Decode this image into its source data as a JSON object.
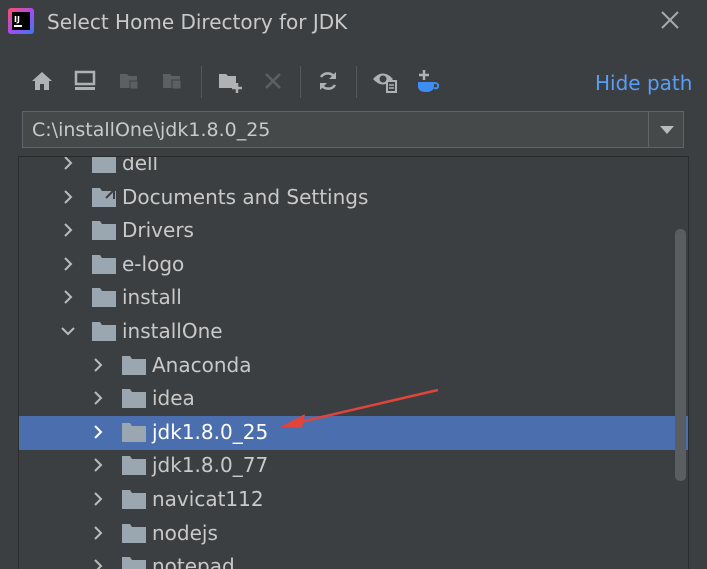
{
  "window": {
    "title": "Select Home Directory for JDK",
    "logo_text": "IJ"
  },
  "toolbar": {
    "hide_path_label": "Hide path",
    "buttons": [
      "home-icon",
      "desktop-icon",
      "project-icon",
      "module-icon",
      "new-folder-icon",
      "delete-icon",
      "refresh-icon",
      "show-hidden-icon",
      "java-download-icon"
    ]
  },
  "path": {
    "value": "C:\\installOne\\jdk1.8.0_25"
  },
  "tree": {
    "rows": [
      {
        "label": "dell",
        "expanded": false,
        "level": 0
      },
      {
        "label": "Documents and Settings",
        "expanded": false,
        "level": 0
      },
      {
        "label": "Drivers",
        "expanded": false,
        "level": 0
      },
      {
        "label": "e-logo",
        "expanded": false,
        "level": 0
      },
      {
        "label": "install",
        "expanded": false,
        "level": 0
      },
      {
        "label": "installOne",
        "expanded": true,
        "level": 0
      },
      {
        "label": "Anaconda",
        "expanded": false,
        "level": 1
      },
      {
        "label": "idea",
        "expanded": false,
        "level": 1
      },
      {
        "label": "jdk1.8.0_25",
        "expanded": false,
        "level": 1,
        "selected": true
      },
      {
        "label": "jdk1.8.0_77",
        "expanded": false,
        "level": 1
      },
      {
        "label": "navicat112",
        "expanded": false,
        "level": 1
      },
      {
        "label": "nodejs",
        "expanded": false,
        "level": 1
      },
      {
        "label": "notepad",
        "expanded": false,
        "level": 1
      }
    ]
  },
  "colors": {
    "background": "#3c3f41",
    "selection": "#4b6eaf",
    "link": "#589df6",
    "annotation_arrow": "#e0443a"
  }
}
